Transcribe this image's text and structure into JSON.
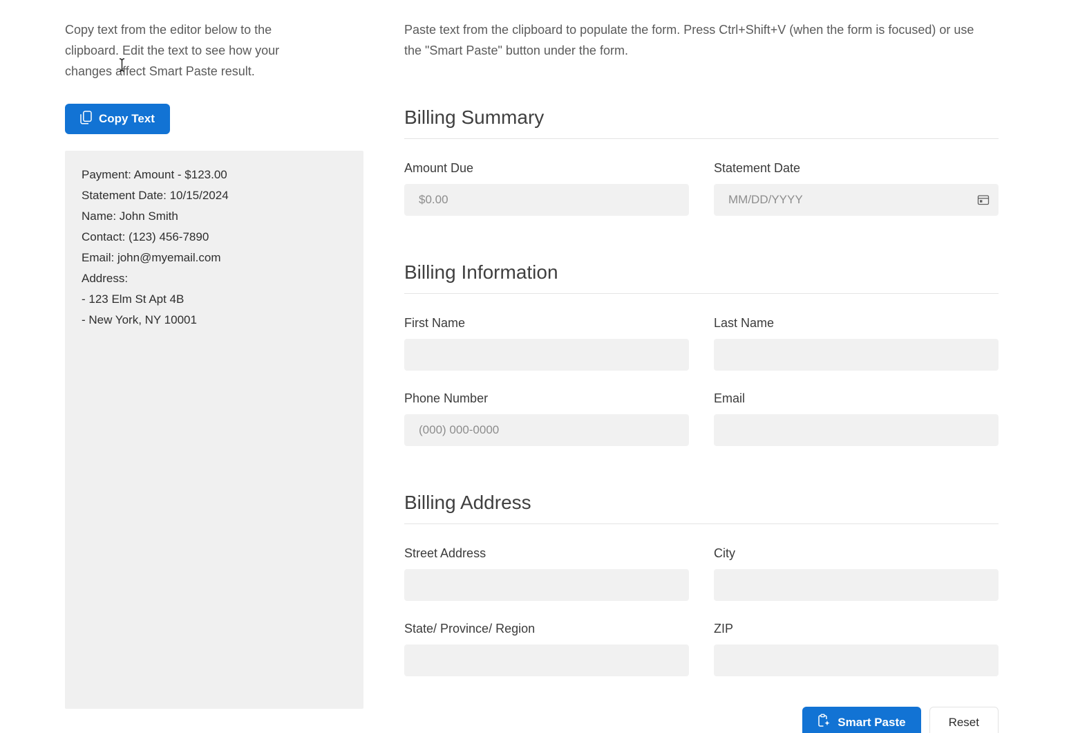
{
  "left_panel": {
    "instructions": "Copy text from the editor below to the clipboard. Edit the text to see how your changes affect Smart Paste result.",
    "copy_button_label": "Copy Text",
    "editor_lines": [
      "Payment: Amount - $123.00",
      "Statement Date: 10/15/2024",
      "Name: John Smith",
      "Contact: (123) 456-7890",
      "Email: john@myemail.com",
      "Address:",
      "- 123 Elm St Apt 4B",
      "- New York, NY 10001"
    ]
  },
  "form_panel": {
    "instructions": "Paste text from the clipboard to populate the form. Press Ctrl+Shift+V (when the form is focused) or use the \"Smart Paste\" button under the form.",
    "sections": [
      {
        "title": "Billing Summary",
        "fields": [
          {
            "label": "Amount Due",
            "placeholder": "$0.00",
            "value": ""
          },
          {
            "label": "Statement Date",
            "placeholder": "MM/DD/YYYY",
            "value": "",
            "icon": "calendar-icon"
          }
        ]
      },
      {
        "title": "Billing Information",
        "fields": [
          {
            "label": "First Name",
            "placeholder": "",
            "value": ""
          },
          {
            "label": "Last Name",
            "placeholder": "",
            "value": ""
          },
          {
            "label": "Phone Number",
            "placeholder": "(000) 000-0000",
            "value": ""
          },
          {
            "label": "Email",
            "placeholder": "",
            "value": ""
          }
        ]
      },
      {
        "title": "Billing Address",
        "fields": [
          {
            "label": "Street Address",
            "placeholder": "",
            "value": ""
          },
          {
            "label": "City",
            "placeholder": "",
            "value": ""
          },
          {
            "label": "State/ Province/ Region",
            "placeholder": "",
            "value": ""
          },
          {
            "label": "ZIP",
            "placeholder": "",
            "value": ""
          }
        ]
      }
    ],
    "smart_paste_button_label": "Smart Paste",
    "reset_button_label": "Reset"
  },
  "colors": {
    "accent_blue": "#1273d4",
    "input_background": "#f1f1f1",
    "editor_background": "#f0f0f0",
    "heading_text": "#3f3f3f",
    "muted_text": "#5a5a5a",
    "divider": "#e4e4e4"
  }
}
